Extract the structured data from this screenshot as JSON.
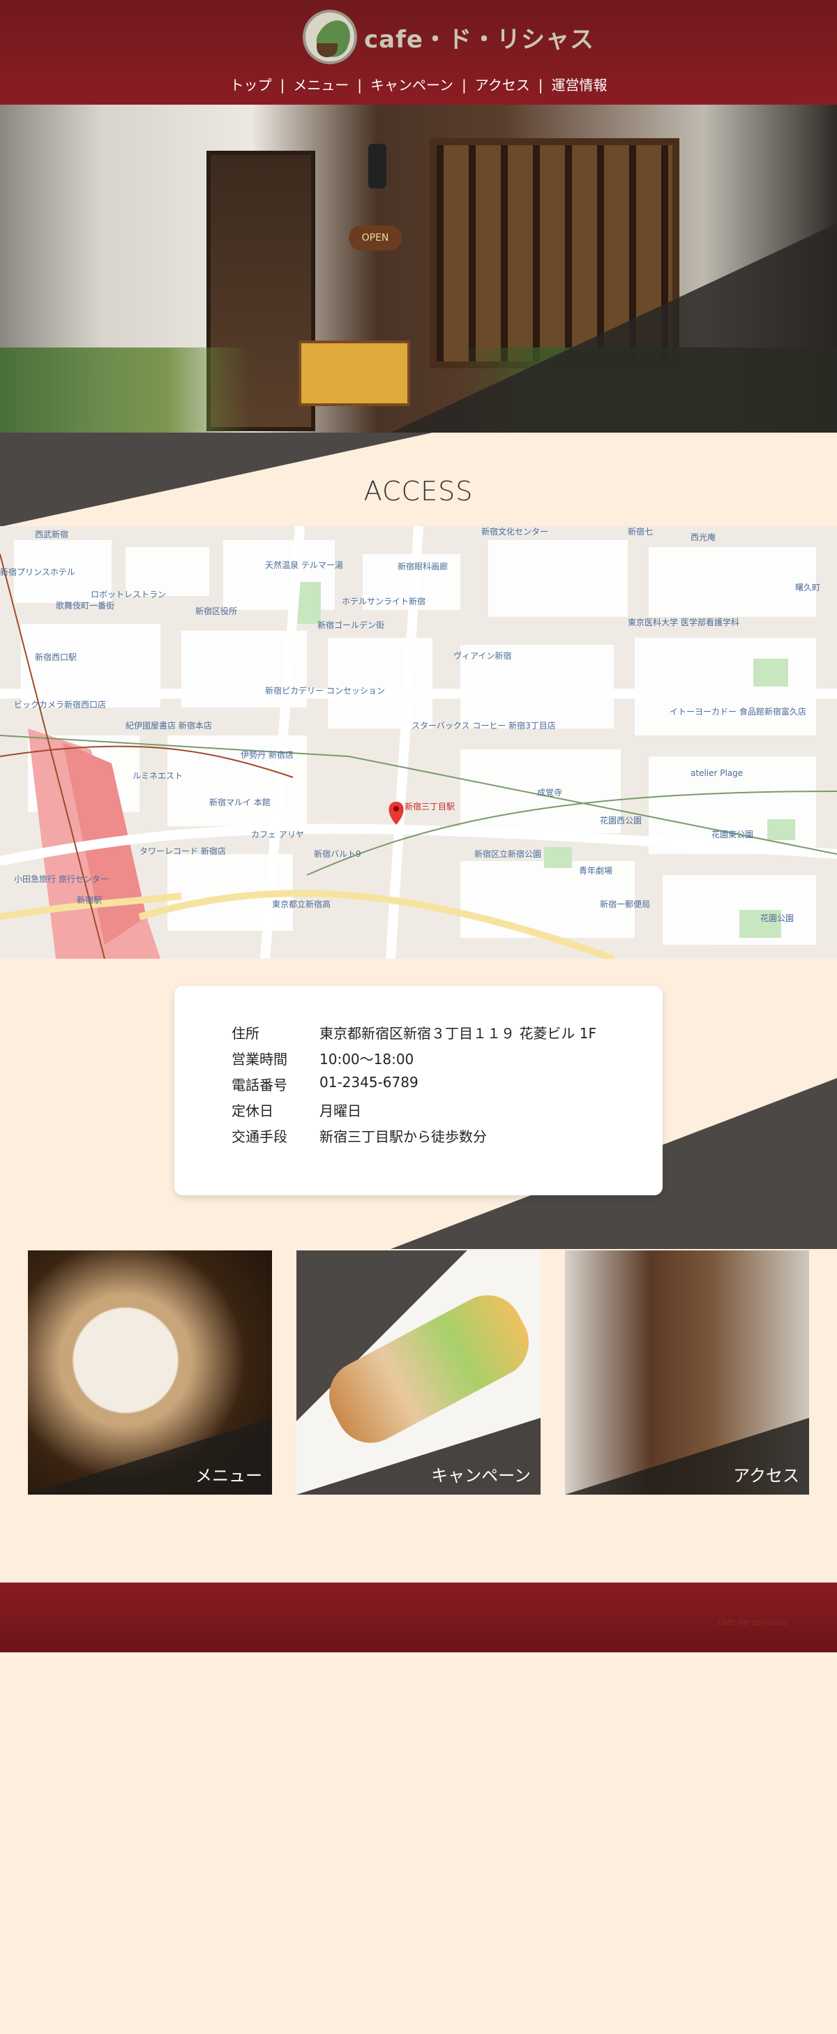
{
  "header": {
    "logo_text": "cafe・ド・リシャス",
    "nav": [
      "トップ",
      "メニュー",
      "キャンペーン",
      "アクセス",
      "運営情報"
    ],
    "nav_separator": "|"
  },
  "hero": {
    "sign_text": "OPEN"
  },
  "access": {
    "title": "ACCESS"
  },
  "map": {
    "marker_label": "新宿三丁目駅",
    "labels": [
      {
        "text": "西武新宿"
      },
      {
        "text": "新宿文化センター"
      },
      {
        "text": "新宿七"
      },
      {
        "text": "西光庵"
      },
      {
        "text": "新宿プリンスホテル"
      },
      {
        "text": "ロボットレストラン"
      },
      {
        "text": "天然温泉 テルマー湯"
      },
      {
        "text": "新宿眼科画廊"
      },
      {
        "text": "歌舞伎町一番街"
      },
      {
        "text": "新宿区役所"
      },
      {
        "text": "ホテルサンライト新宿"
      },
      {
        "text": "新宿ゴールデン街"
      },
      {
        "text": "東京医科大学 医学部看護学科"
      },
      {
        "text": "曙久町"
      },
      {
        "text": "新宿西口駅"
      },
      {
        "text": "ヴィアイン新宿"
      },
      {
        "text": "新宿ピカデリー コンセッション"
      },
      {
        "text": "ビックカメラ新宿西口店"
      },
      {
        "text": "紀伊國屋書店 新宿本店"
      },
      {
        "text": "スターバックス コーヒー 新宿3丁目店"
      },
      {
        "text": "イトーヨーカドー 食品館新宿富久店"
      },
      {
        "text": "伊勢丹 新宿店"
      },
      {
        "text": "ルミネエスト"
      },
      {
        "text": "新宿マルイ 本館"
      },
      {
        "text": "成覚寺"
      },
      {
        "text": "atelier Plage"
      },
      {
        "text": "カフェ アリヤ"
      },
      {
        "text": "花園西公園"
      },
      {
        "text": "花園東公園"
      },
      {
        "text": "タワーレコード 新宿店"
      },
      {
        "text": "新宿バルト9"
      },
      {
        "text": "新宿区立新宿公園"
      },
      {
        "text": "青年劇場"
      },
      {
        "text": "新宿駅"
      },
      {
        "text": "東京都立新宿高"
      },
      {
        "text": "新宿一郵便局"
      },
      {
        "text": "花園公園"
      },
      {
        "text": "小田急旅行 旅行センター"
      }
    ]
  },
  "info": {
    "rows": [
      {
        "key": "住所",
        "value": "東京都新宿区新宿３丁目１１９ 花菱ビル 1F"
      },
      {
        "key": "営業時間",
        "value": "10:00〜18:00"
      },
      {
        "key": "電話番号",
        "value": "01-2345-6789"
      },
      {
        "key": "定休日",
        "value": "月曜日"
      },
      {
        "key": "交通手段",
        "value": "新宿三丁目駅から徒歩数分"
      }
    ]
  },
  "cards": [
    {
      "label": "メニュー"
    },
    {
      "label": "キャンペーン"
    },
    {
      "label": "アクセス"
    }
  ],
  "footer": {
    "copyright": "cafe de delicious"
  },
  "colors": {
    "header": "#8a1c22",
    "background": "#fdeedd",
    "dark_band": "#4b4846",
    "accent_pin": "#e53935"
  }
}
